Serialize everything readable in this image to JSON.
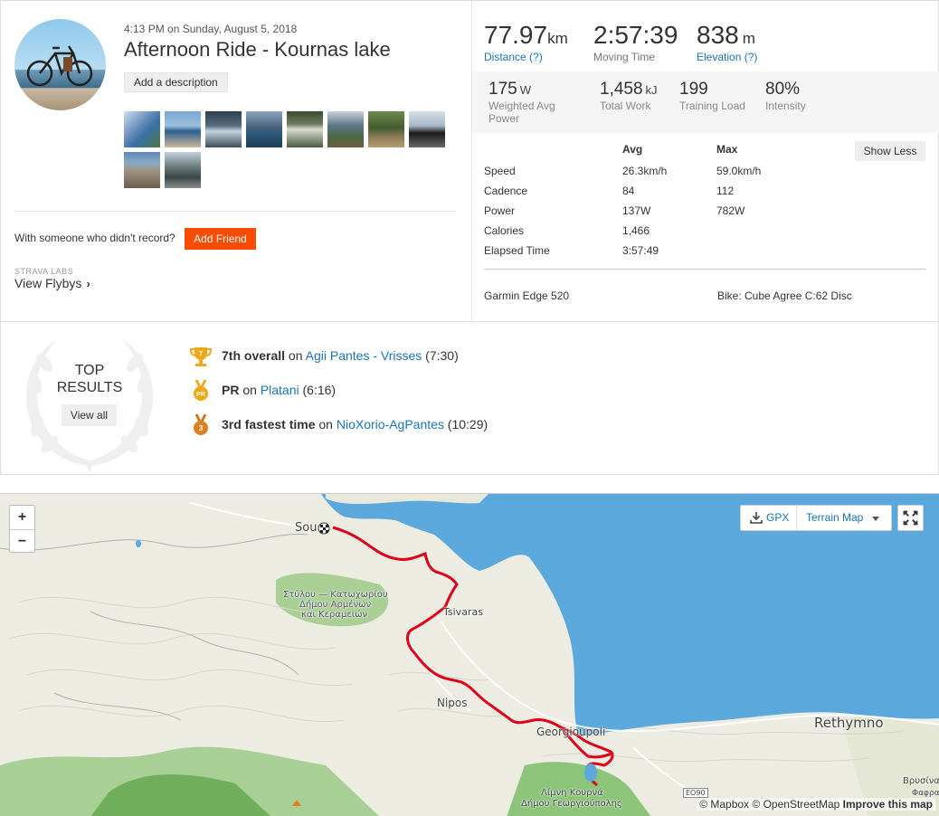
{
  "activity": {
    "date": "4:13 PM on Sunday, August 5, 2018",
    "title": "Afternoon Ride - Kournas lake",
    "add_description": "Add a description",
    "with_someone": "With someone who didn't record?",
    "add_friend": "Add Friend",
    "labs_label": "STRAVA LABS",
    "flyby": "View Flybys"
  },
  "primary_stats": [
    {
      "value": "77.97",
      "unit": "km",
      "label": "Distance (?)"
    },
    {
      "value": "2:57:39",
      "unit": "",
      "label": "Moving Time"
    },
    {
      "value": "838",
      "unit": "m",
      "label": "Elevation (?)"
    }
  ],
  "secondary_stats": [
    {
      "value": "175",
      "unit": "W",
      "label": "Weighted Avg Power"
    },
    {
      "value": "1,458",
      "unit": "kJ",
      "label": "Total Work"
    },
    {
      "value": "199",
      "unit": "",
      "label": "Training Load"
    },
    {
      "value": "80%",
      "unit": "",
      "label": "Intensity"
    }
  ],
  "details_table": {
    "headers": [
      "Avg",
      "Max"
    ],
    "show_less": "Show Less",
    "rows": [
      {
        "label": "Speed",
        "avg": "26.3km/h",
        "max": "59.0km/h"
      },
      {
        "label": "Cadence",
        "avg": "84",
        "max": "112"
      },
      {
        "label": "Power",
        "avg": "137W",
        "max": "782W"
      },
      {
        "label": "Calories",
        "avg": "1,466",
        "max": ""
      },
      {
        "label": "Elapsed Time",
        "avg": "3:57:49",
        "max": ""
      }
    ],
    "device": "Garmin Edge 520",
    "bike": "Bike: Cube Agree C:62 Disc"
  },
  "top_results": {
    "label_line1": "TOP",
    "label_line2": "RESULTS",
    "view_all": "View all",
    "items": [
      {
        "rank": "7th overall",
        "on": "on",
        "segment": "Agii Pantes - Vrisses",
        "time": "(7:30)",
        "icon": "trophy-icon",
        "badge": "7"
      },
      {
        "rank": "PR",
        "on": "on",
        "segment": "Platani",
        "time": "(6:16)",
        "icon": "pr-medal-icon",
        "badge": "PR"
      },
      {
        "rank": "3rd fastest time",
        "on": "on",
        "segment": "NioXorio-AgPantes",
        "time": "(10:29)",
        "icon": "bronze-medal-icon",
        "badge": "3"
      }
    ]
  },
  "map": {
    "zoom_in": "+",
    "zoom_out": "−",
    "gpx": "GPX",
    "terrain": "Terrain Map",
    "labels": {
      "souda": "Sou",
      "stylos_1": "Στύλου — Κατωχωρίου",
      "stylos_2": "Δήμου Αρμένων",
      "stylos_3": "και Κεραμειών",
      "tsivaras": "Tsivaras",
      "nipos": "Nipos",
      "georgioupoli": "Georgioupoli",
      "rethymno": "Rethymno",
      "kourna_1": "Λίμνη Κουρνά",
      "kourna_2": "Δήμου Γεωργιούπολης",
      "road": "EO90",
      "vrysina": "Βρυσίνα",
      "fafra": "Φαφρα"
    },
    "attrib_mapbox": "© Mapbox",
    "attrib_osm": "© OpenStreetMap",
    "attrib_improve": "Improve this map",
    "colors": {
      "sea": "#5ba8dc",
      "land": "#efefe6",
      "route": "#e1001a",
      "forest": "#7fbf6b"
    }
  }
}
